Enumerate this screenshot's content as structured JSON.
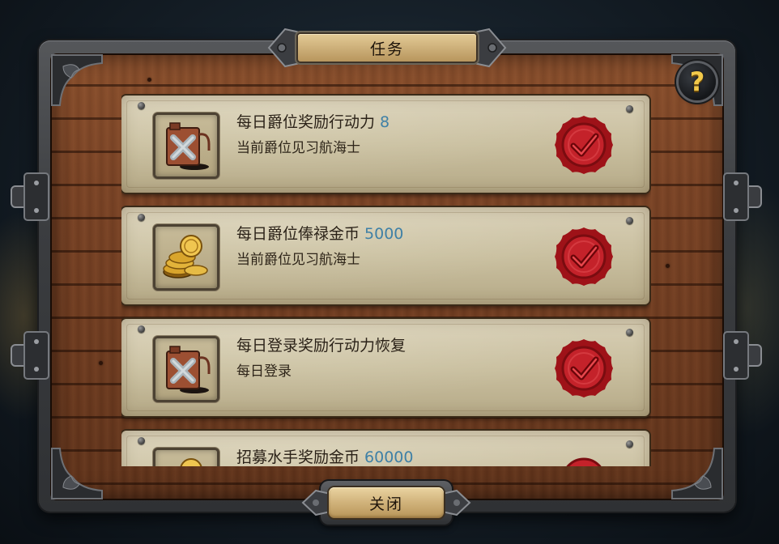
{
  "window": {
    "title": "任务",
    "help_icon": "question-mark-icon",
    "help_glyph": "?"
  },
  "quests": [
    {
      "title": "每日爵位奖励行动力",
      "value": "8",
      "subtitle": "当前爵位见习航海士",
      "icon": "fuel-canister-icon",
      "status_icon": "red-wax-seal-check-icon"
    },
    {
      "title": "每日爵位俸禄金币",
      "value": "5000",
      "subtitle": "当前爵位见习航海士",
      "icon": "gold-coins-icon",
      "status_icon": "red-wax-seal-check-icon"
    },
    {
      "title": "每日登录奖励行动力恢复",
      "value": "",
      "subtitle": "每日登录",
      "icon": "fuel-canister-icon",
      "status_icon": "red-wax-seal-check-icon"
    },
    {
      "title": "招募水手奖励金币",
      "value": "60000",
      "subtitle": "",
      "icon": "gold-coins-icon",
      "status_icon": "red-wax-seal-check-icon"
    }
  ],
  "footer": {
    "close_label": "关闭"
  },
  "colors": {
    "value_accent": "#3f80a6",
    "seal_red": "#b3161c",
    "parchment": "#c9bf9f",
    "wood": "#7a4325",
    "iron": "#3b3d40",
    "gold": "#f2c94a"
  }
}
